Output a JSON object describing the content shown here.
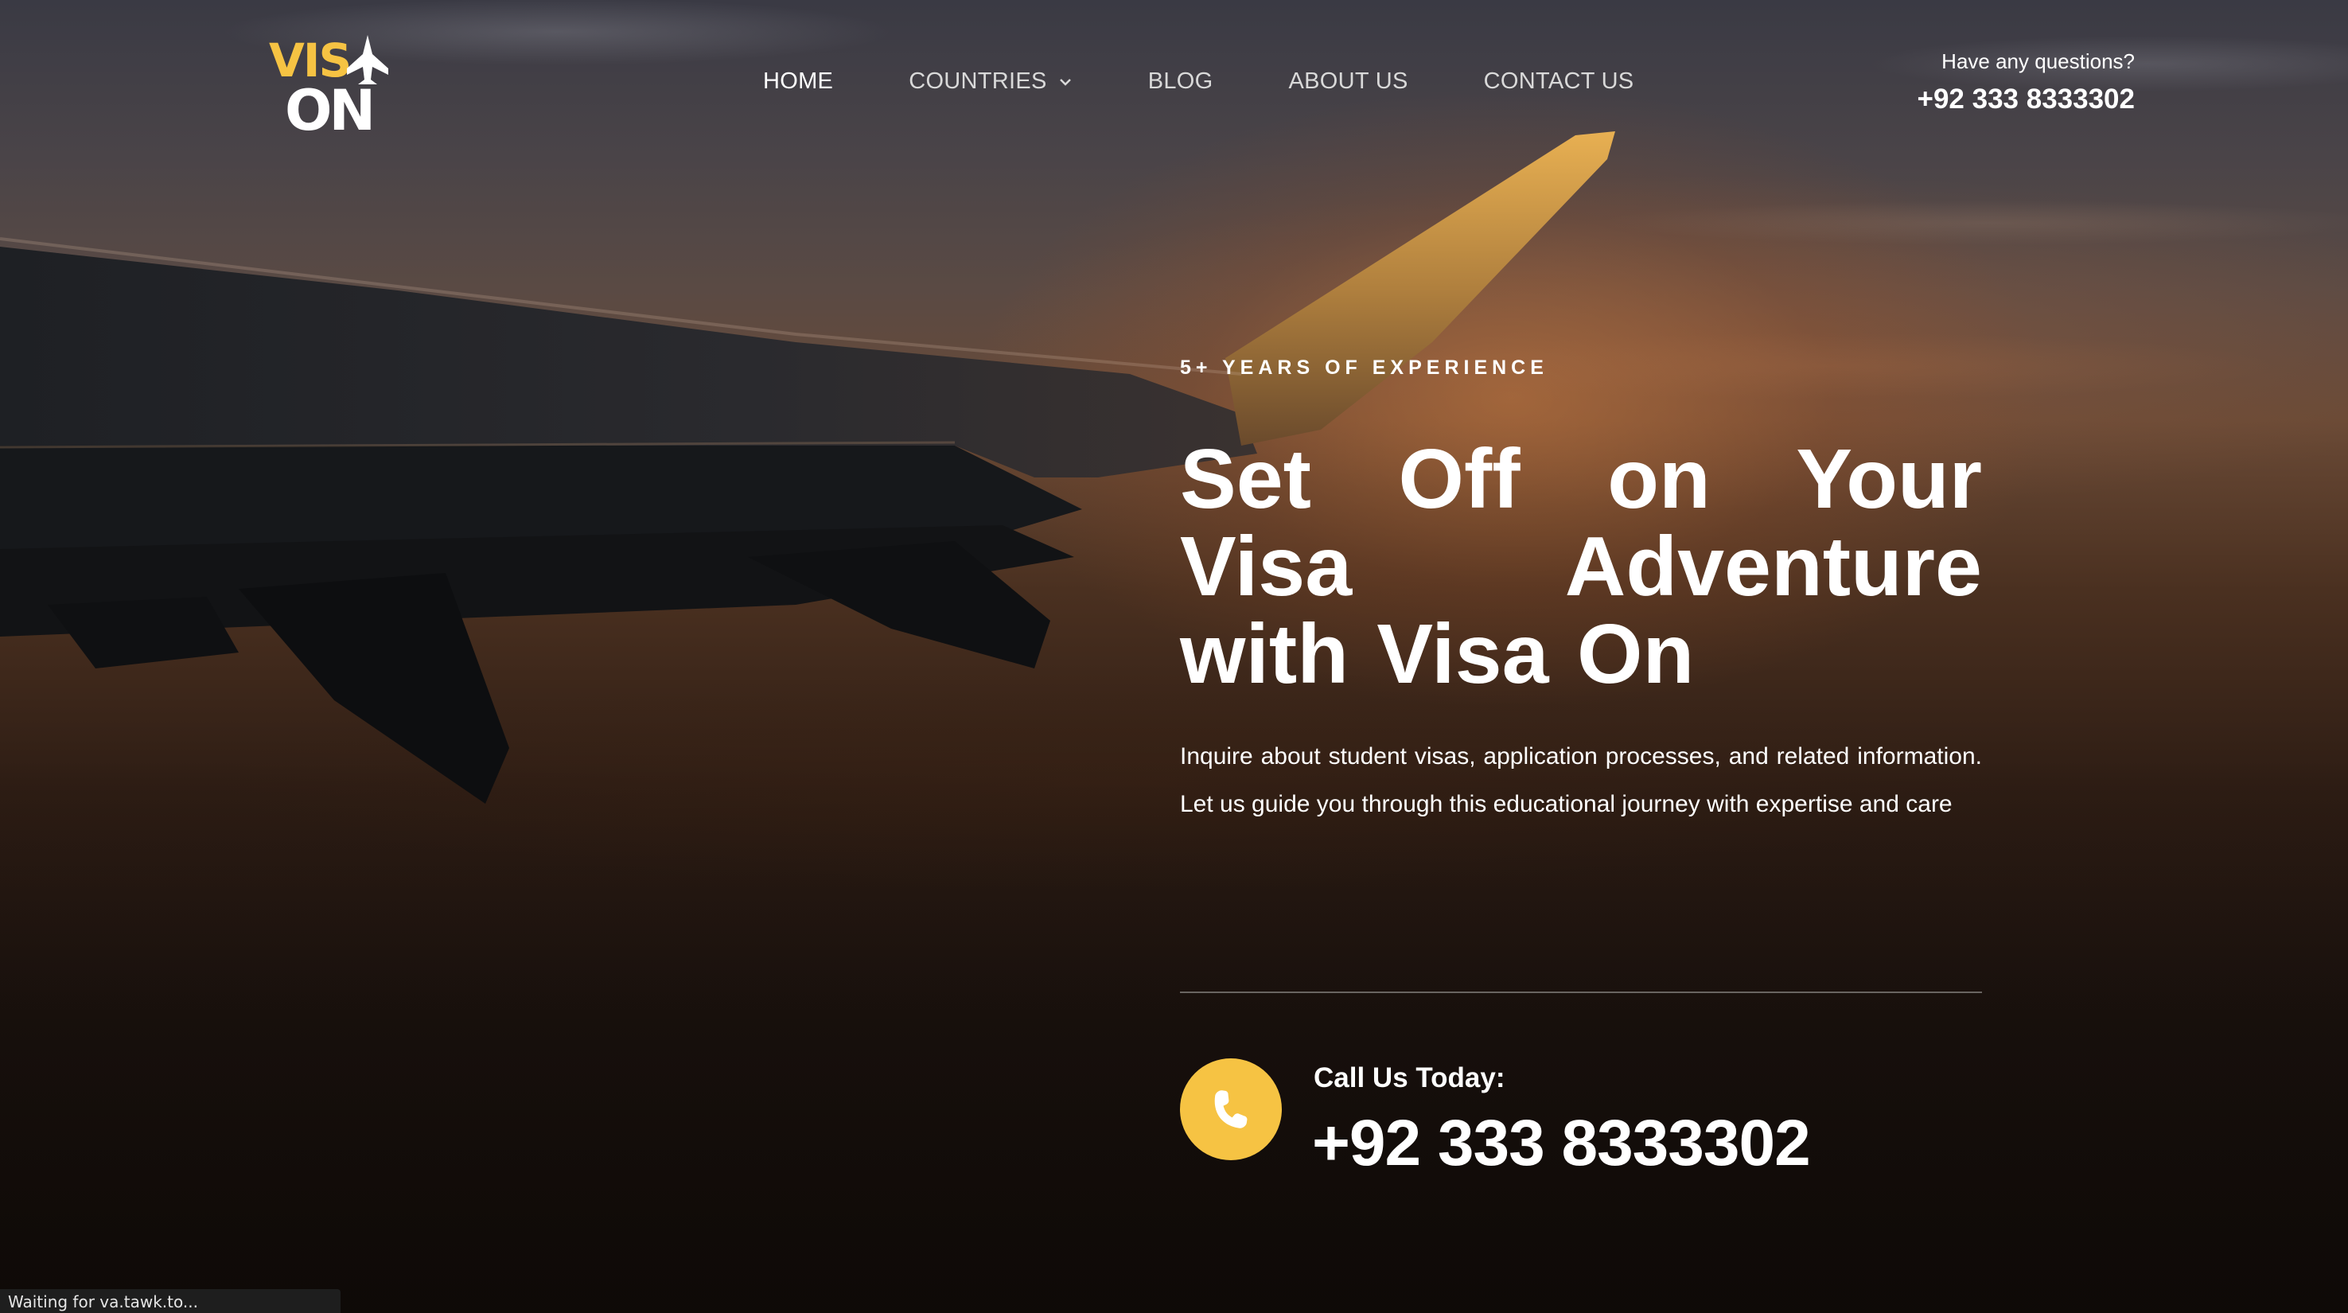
{
  "logo": {
    "text_top": "VIS",
    "text_bottom": "ON",
    "accent_color": "#f6c343",
    "icon": "airplane-icon"
  },
  "nav": {
    "items": [
      {
        "label": "HOME",
        "active": true
      },
      {
        "label": "COUNTRIES",
        "has_dropdown": true
      },
      {
        "label": "BLOG"
      },
      {
        "label": "ABOUT US"
      },
      {
        "label": "CONTACT US"
      }
    ]
  },
  "header_contact": {
    "question": "Have any questions?",
    "phone": "+92 333 8333302"
  },
  "hero": {
    "eyebrow": "5+ YEARS OF EXPERIENCE",
    "headline": "Set Off on Your Visa Adventure with Visa On",
    "lead": "Inquire about student visas, application processes, and related information. Let us guide you through this educational journey with expertise and care",
    "call_label": "Call Us Today:",
    "call_phone": "+92 333 8333302",
    "call_icon": "phone-icon",
    "call_icon_color": "#f6c343"
  },
  "status_bar": {
    "text": "Waiting for va.tawk.to..."
  }
}
